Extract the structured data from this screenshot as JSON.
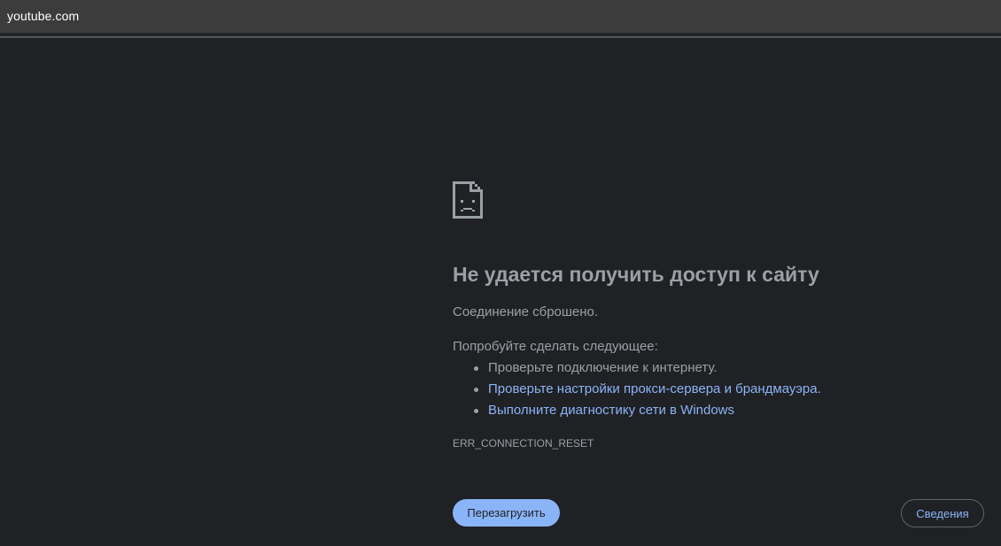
{
  "address_bar": {
    "url": "youtube.com"
  },
  "error": {
    "icon": "sad-page-icon",
    "title": "Не удается получить доступ к сайту",
    "reason": "Соединение сброшено.",
    "suggestions_label": "Попробуйте сделать следующее:",
    "suggestions": [
      {
        "text": "Проверьте подключение к интернету.",
        "is_link": false
      },
      {
        "text": "Проверьте настройки прокси-сервера и брандмауэра.",
        "is_link": true
      },
      {
        "text": "Выполните диагностику сети в Windows",
        "is_link": true
      }
    ],
    "code": "ERR_CONNECTION_RESET"
  },
  "buttons": {
    "reload_label": "Перезагрузить",
    "details_label": "Сведения"
  },
  "colors": {
    "background": "#202124",
    "text": "#9aa0a6",
    "link": "#8ab4f8",
    "primary_button": "#8ab4f8"
  }
}
